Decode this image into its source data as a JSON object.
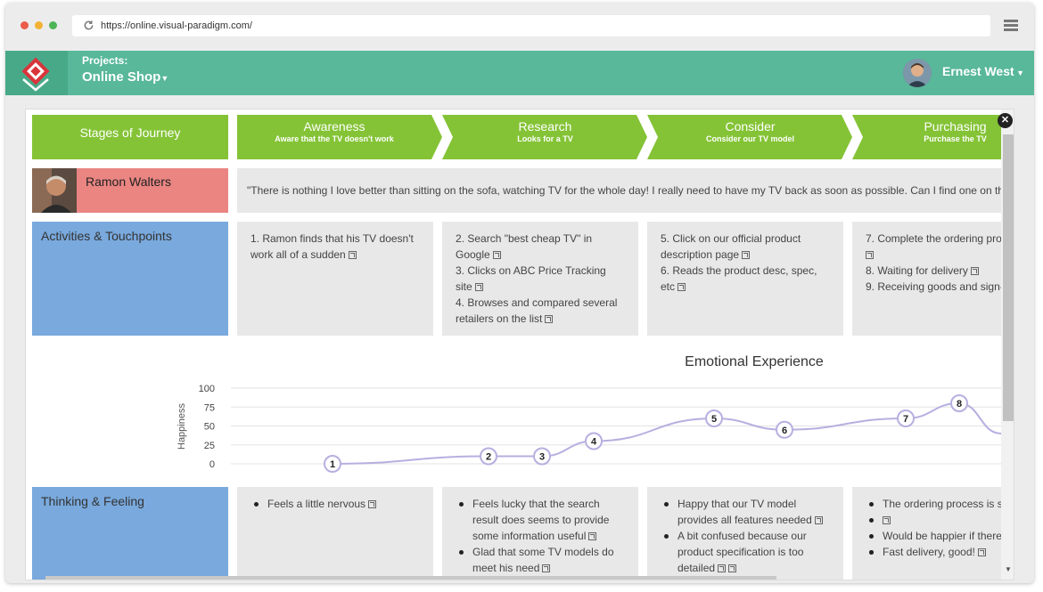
{
  "browser": {
    "url": "https://online.visual-paradigm.com/"
  },
  "app": {
    "projects_label": "Projects:",
    "project_name": "Online Shop",
    "user_name": "Ernest West"
  },
  "journey": {
    "row_header": "Stages of Journey",
    "persona_name": "Ramon Walters",
    "persona_quote": "\"There is nothing I love better than sitting on the sofa, watching TV for the whole day! I really need to have my TV back as soon as possible. Can I find one on the",
    "activities_label": "Activities & Touchpoints",
    "thinking_label": "Thinking & Feeling",
    "stages": [
      {
        "title": "Awareness",
        "subtitle": "Aware that the TV doesn't work"
      },
      {
        "title": "Research",
        "subtitle": "Looks for a TV"
      },
      {
        "title": "Consider",
        "subtitle": "Consider our TV model"
      },
      {
        "title": "Purchasing",
        "subtitle": "Purchase the TV"
      }
    ],
    "activities": [
      [
        "1. Ramon finds that his TV doesn't work all of a sudden"
      ],
      [
        "2. Search \"best cheap TV\" in Google",
        "3. Clicks on ABC Price Tracking site",
        "4. Browses and compared several retailers on the list"
      ],
      [
        "5. Click on our official product description page",
        "6. Reads the product desc, spec, etc"
      ],
      [
        "7. Complete the ordering pro",
        "8. Waiting for delivery",
        "9. Receiving goods and sign-"
      ]
    ],
    "thinking": [
      [
        "Feels a little nervous"
      ],
      [
        "Feels lucky that the search result does seems to provide some information useful",
        "Glad that some TV models do meet his need"
      ],
      [
        "Happy that our TV model provides all features needed",
        "A bit confused because our product specification is too detailed"
      ],
      [
        "The ordering process is s",
        "Would be happier if there discount",
        "Fast delivery, good!"
      ]
    ]
  },
  "chart_data": {
    "type": "line",
    "title": "Emotional Experience",
    "ylabel": "Happiness",
    "ylim": [
      0,
      100
    ],
    "yticks": [
      "100",
      "75",
      "50",
      "25",
      "0"
    ],
    "points": [
      {
        "label": "1",
        "y": 0
      },
      {
        "label": "2",
        "y": 10
      },
      {
        "label": "3",
        "y": 10
      },
      {
        "label": "4",
        "y": 30
      },
      {
        "label": "5",
        "y": 60
      },
      {
        "label": "6",
        "y": 45
      },
      {
        "label": "7",
        "y": 60
      },
      {
        "label": "8",
        "y": 80
      }
    ],
    "line_color": "#b6b0e0"
  },
  "colors": {
    "appbar": "#58b899",
    "stage_green": "#84c336",
    "persona_red": "#ea8582",
    "row_blue": "#79a9dd"
  }
}
